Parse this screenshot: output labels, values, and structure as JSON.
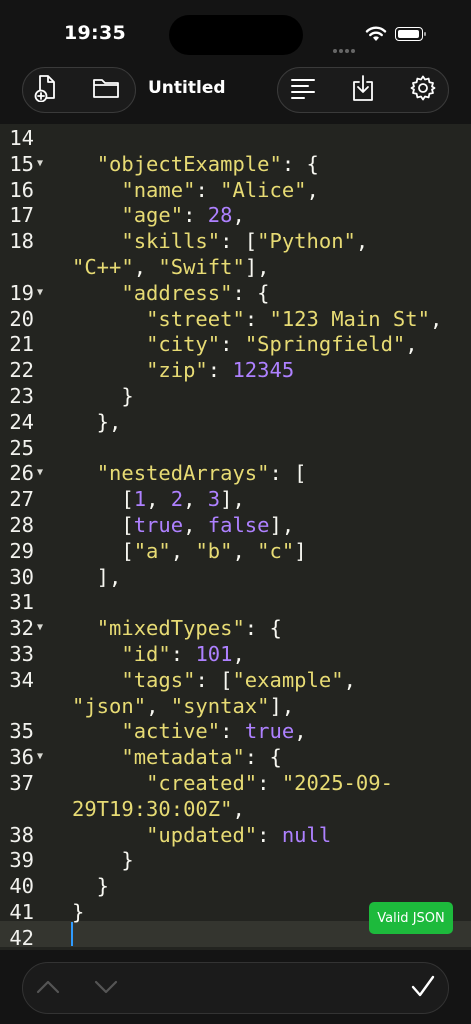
{
  "status_bar": {
    "time": "19:35"
  },
  "toolbar": {
    "title": "Untitled"
  },
  "editor": {
    "badge": "Valid JSON",
    "lines": [
      {
        "num": "14",
        "fold": false,
        "tokens": []
      },
      {
        "num": "15",
        "fold": true,
        "tokens": [
          {
            "t": "  "
          },
          {
            "t": "\"objectExample\"",
            "c": "k"
          },
          {
            "t": ": {"
          }
        ]
      },
      {
        "num": "16",
        "fold": false,
        "tokens": [
          {
            "t": "    "
          },
          {
            "t": "\"name\"",
            "c": "k"
          },
          {
            "t": ": "
          },
          {
            "t": "\"Alice\"",
            "c": "k"
          },
          {
            "t": ","
          }
        ]
      },
      {
        "num": "17",
        "fold": false,
        "tokens": [
          {
            "t": "    "
          },
          {
            "t": "\"age\"",
            "c": "k"
          },
          {
            "t": ": "
          },
          {
            "t": "28",
            "c": "n"
          },
          {
            "t": ","
          }
        ]
      },
      {
        "num": "18",
        "fold": false,
        "tokens": [
          {
            "t": "    "
          },
          {
            "t": "\"skills\"",
            "c": "k"
          },
          {
            "t": ": ["
          },
          {
            "t": "\"Python\"",
            "c": "k"
          },
          {
            "t": ","
          }
        ]
      },
      {
        "num": "",
        "fold": false,
        "tokens": [
          {
            "t": "\"C++\"",
            "c": "k"
          },
          {
            "t": ", "
          },
          {
            "t": "\"Swift\"",
            "c": "k"
          },
          {
            "t": "],"
          }
        ]
      },
      {
        "num": "19",
        "fold": true,
        "tokens": [
          {
            "t": "    "
          },
          {
            "t": "\"address\"",
            "c": "k"
          },
          {
            "t": ": {"
          }
        ]
      },
      {
        "num": "20",
        "fold": false,
        "tokens": [
          {
            "t": "      "
          },
          {
            "t": "\"street\"",
            "c": "k"
          },
          {
            "t": ": "
          },
          {
            "t": "\"123 Main St\"",
            "c": "k"
          },
          {
            "t": ","
          }
        ]
      },
      {
        "num": "21",
        "fold": false,
        "tokens": [
          {
            "t": "      "
          },
          {
            "t": "\"city\"",
            "c": "k"
          },
          {
            "t": ": "
          },
          {
            "t": "\"Springfield\"",
            "c": "k"
          },
          {
            "t": ","
          }
        ]
      },
      {
        "num": "22",
        "fold": false,
        "tokens": [
          {
            "t": "      "
          },
          {
            "t": "\"zip\"",
            "c": "k"
          },
          {
            "t": ": "
          },
          {
            "t": "12345",
            "c": "n"
          }
        ]
      },
      {
        "num": "23",
        "fold": false,
        "tokens": [
          {
            "t": "    }"
          }
        ]
      },
      {
        "num": "24",
        "fold": false,
        "tokens": [
          {
            "t": "  },"
          }
        ]
      },
      {
        "num": "25",
        "fold": false,
        "tokens": []
      },
      {
        "num": "26",
        "fold": true,
        "tokens": [
          {
            "t": "  "
          },
          {
            "t": "\"nestedArrays\"",
            "c": "k"
          },
          {
            "t": ": ["
          }
        ]
      },
      {
        "num": "27",
        "fold": false,
        "tokens": [
          {
            "t": "    ["
          },
          {
            "t": "1",
            "c": "n"
          },
          {
            "t": ", "
          },
          {
            "t": "2",
            "c": "n"
          },
          {
            "t": ", "
          },
          {
            "t": "3",
            "c": "n"
          },
          {
            "t": "],"
          }
        ]
      },
      {
        "num": "28",
        "fold": false,
        "tokens": [
          {
            "t": "    ["
          },
          {
            "t": "true",
            "c": "n"
          },
          {
            "t": ", "
          },
          {
            "t": "false",
            "c": "n"
          },
          {
            "t": "],"
          }
        ]
      },
      {
        "num": "29",
        "fold": false,
        "tokens": [
          {
            "t": "    ["
          },
          {
            "t": "\"a\"",
            "c": "k"
          },
          {
            "t": ", "
          },
          {
            "t": "\"b\"",
            "c": "k"
          },
          {
            "t": ", "
          },
          {
            "t": "\"c\"",
            "c": "k"
          },
          {
            "t": "]"
          }
        ]
      },
      {
        "num": "30",
        "fold": false,
        "tokens": [
          {
            "t": "  ],"
          }
        ]
      },
      {
        "num": "31",
        "fold": false,
        "tokens": []
      },
      {
        "num": "32",
        "fold": true,
        "tokens": [
          {
            "t": "  "
          },
          {
            "t": "\"mixedTypes\"",
            "c": "k"
          },
          {
            "t": ": {"
          }
        ]
      },
      {
        "num": "33",
        "fold": false,
        "tokens": [
          {
            "t": "    "
          },
          {
            "t": "\"id\"",
            "c": "k"
          },
          {
            "t": ": "
          },
          {
            "t": "101",
            "c": "n"
          },
          {
            "t": ","
          }
        ]
      },
      {
        "num": "34",
        "fold": false,
        "tokens": [
          {
            "t": "    "
          },
          {
            "t": "\"tags\"",
            "c": "k"
          },
          {
            "t": ": ["
          },
          {
            "t": "\"example\"",
            "c": "k"
          },
          {
            "t": ","
          }
        ]
      },
      {
        "num": "",
        "fold": false,
        "tokens": [
          {
            "t": "\"json\"",
            "c": "k"
          },
          {
            "t": ", "
          },
          {
            "t": "\"syntax\"",
            "c": "k"
          },
          {
            "t": "],"
          }
        ]
      },
      {
        "num": "35",
        "fold": false,
        "tokens": [
          {
            "t": "    "
          },
          {
            "t": "\"active\"",
            "c": "k"
          },
          {
            "t": ": "
          },
          {
            "t": "true",
            "c": "n"
          },
          {
            "t": ","
          }
        ]
      },
      {
        "num": "36",
        "fold": true,
        "tokens": [
          {
            "t": "    "
          },
          {
            "t": "\"metadata\"",
            "c": "k"
          },
          {
            "t": ": {"
          }
        ]
      },
      {
        "num": "37",
        "fold": false,
        "tokens": [
          {
            "t": "      "
          },
          {
            "t": "\"created\"",
            "c": "k"
          },
          {
            "t": ": "
          },
          {
            "t": "\"2025-09-",
            "c": "k"
          }
        ]
      },
      {
        "num": "",
        "fold": false,
        "tokens": [
          {
            "t": "29T19:30:00Z\"",
            "c": "k"
          },
          {
            "t": ","
          }
        ]
      },
      {
        "num": "38",
        "fold": false,
        "tokens": [
          {
            "t": "      "
          },
          {
            "t": "\"updated\"",
            "c": "k"
          },
          {
            "t": ": "
          },
          {
            "t": "null",
            "c": "n"
          }
        ]
      },
      {
        "num": "39",
        "fold": false,
        "tokens": [
          {
            "t": "    }"
          }
        ]
      },
      {
        "num": "40",
        "fold": false,
        "tokens": [
          {
            "t": "  }"
          }
        ]
      },
      {
        "num": "41",
        "fold": false,
        "tokens": [
          {
            "t": "}"
          }
        ]
      },
      {
        "num": "42",
        "fold": false,
        "tokens": []
      }
    ]
  },
  "icons": {
    "new_file": "new-file-icon",
    "open_folder": "folder-icon",
    "format": "align-left-icon",
    "save": "download-icon",
    "settings": "gear-icon",
    "prev": "chevron-up-icon",
    "next": "chevron-down-icon",
    "done": "checkmark-icon"
  },
  "colors": {
    "key": "#e7db74",
    "number": "#ae81ff",
    "badge": "#1dba3c",
    "caret": "#2f9bff"
  }
}
